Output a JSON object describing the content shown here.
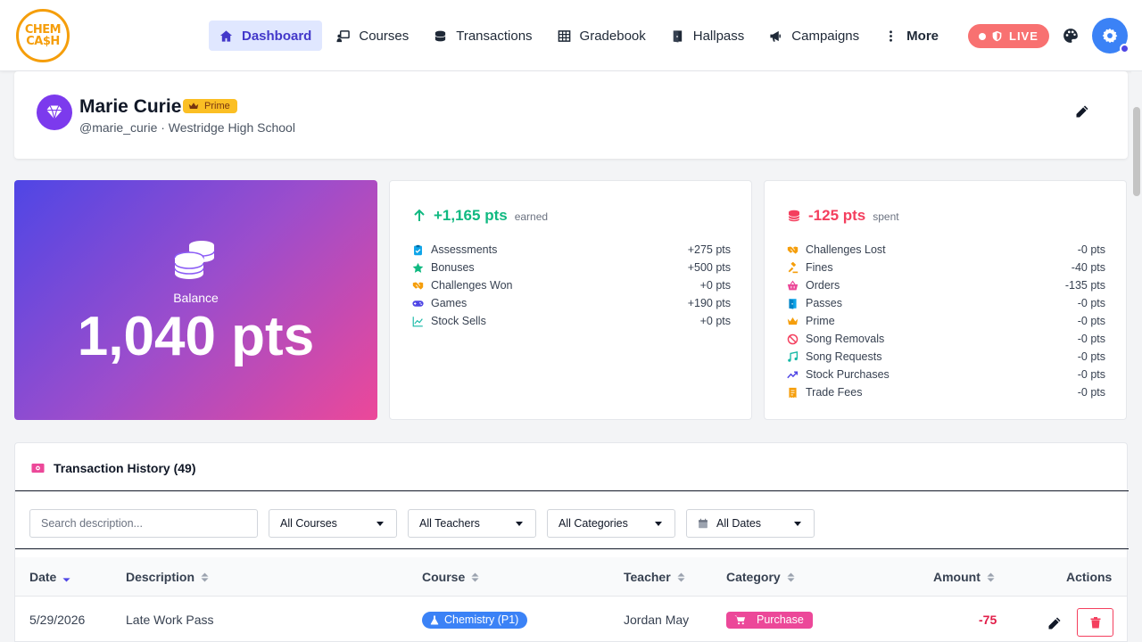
{
  "logo": {
    "line1": "CHEM",
    "line2": "CA$H"
  },
  "nav": [
    {
      "label": "Dashboard",
      "icon": "home-icon"
    },
    {
      "label": "Courses",
      "icon": "chalkboard-teacher-icon"
    },
    {
      "label": "Transactions",
      "icon": "coins-icon"
    },
    {
      "label": "Gradebook",
      "icon": "table-grid-icon"
    },
    {
      "label": "Hallpass",
      "icon": "door-icon"
    },
    {
      "label": "Campaigns",
      "icon": "megaphone-icon"
    },
    {
      "label": "More",
      "icon": "vertical-dots-icon"
    }
  ],
  "live_label": "LIVE",
  "profile": {
    "name": "Marie Curie",
    "badge": "Prime",
    "subtitle": "@marie_curie · Westridge High School"
  },
  "balance": {
    "label": "Balance",
    "value": "1,040 pts"
  },
  "earned": {
    "total": "+1,165 pts",
    "suffix": "earned",
    "rows": [
      {
        "label": "Assessments",
        "value": "+275 pts",
        "icon": "clipboard-check-icon",
        "color": "#0ea5e9"
      },
      {
        "label": "Bonuses",
        "value": "+500 pts",
        "icon": "star-icon",
        "color": "#10b981"
      },
      {
        "label": "Challenges Won",
        "value": "+0 pts",
        "icon": "handshake-icon",
        "color": "#f59e0b"
      },
      {
        "label": "Games",
        "value": "+190 pts",
        "icon": "gamepad-icon",
        "color": "#4f46e5"
      },
      {
        "label": "Stock Sells",
        "value": "+0 pts",
        "icon": "chart-line-icon",
        "color": "#14b8a6"
      }
    ]
  },
  "spent": {
    "total": "-125 pts",
    "suffix": "spent",
    "rows": [
      {
        "label": "Challenges Lost",
        "value": "-0 pts",
        "icon": "handshake-icon",
        "color": "#f59e0b"
      },
      {
        "label": "Fines",
        "value": "-40 pts",
        "icon": "gavel-icon",
        "color": "#f59e0b"
      },
      {
        "label": "Orders",
        "value": "-135 pts",
        "icon": "basket-icon",
        "color": "#ec4899"
      },
      {
        "label": "Passes",
        "value": "-0 pts",
        "icon": "door-icon",
        "color": "#0ea5e9"
      },
      {
        "label": "Prime",
        "value": "-0 pts",
        "icon": "crown-icon",
        "color": "#f59e0b"
      },
      {
        "label": "Song Removals",
        "value": "-0 pts",
        "icon": "ban-icon",
        "color": "#f43f5e"
      },
      {
        "label": "Song Requests",
        "value": "-0 pts",
        "icon": "music-icon",
        "color": "#14b8a6"
      },
      {
        "label": "Stock Purchases",
        "value": "-0 pts",
        "icon": "chart-trend-icon",
        "color": "#4f46e5"
      },
      {
        "label": "Trade Fees",
        "value": "-0 pts",
        "icon": "receipt-icon",
        "color": "#f59e0b"
      }
    ]
  },
  "transactions": {
    "title": "Transaction History (49)",
    "search_placeholder": "Search description...",
    "filters": {
      "courses": "All Courses",
      "teachers": "All Teachers",
      "categories": "All Categories",
      "dates": "All Dates"
    },
    "columns": {
      "date": "Date",
      "description": "Description",
      "course": "Course",
      "teacher": "Teacher",
      "category": "Category",
      "amount": "Amount",
      "actions": "Actions"
    },
    "rows": [
      {
        "date": "5/29/2026",
        "description": "Late Work Pass",
        "course": "Chemistry (P1)",
        "teacher": "Jordan May",
        "category": "Purchase",
        "amount": "-75"
      }
    ]
  },
  "colors": {
    "accent": "#4f46e5",
    "earned": "#10b981",
    "spent": "#f43f5e",
    "live": "#f87171",
    "brand": "#f59e0b"
  }
}
